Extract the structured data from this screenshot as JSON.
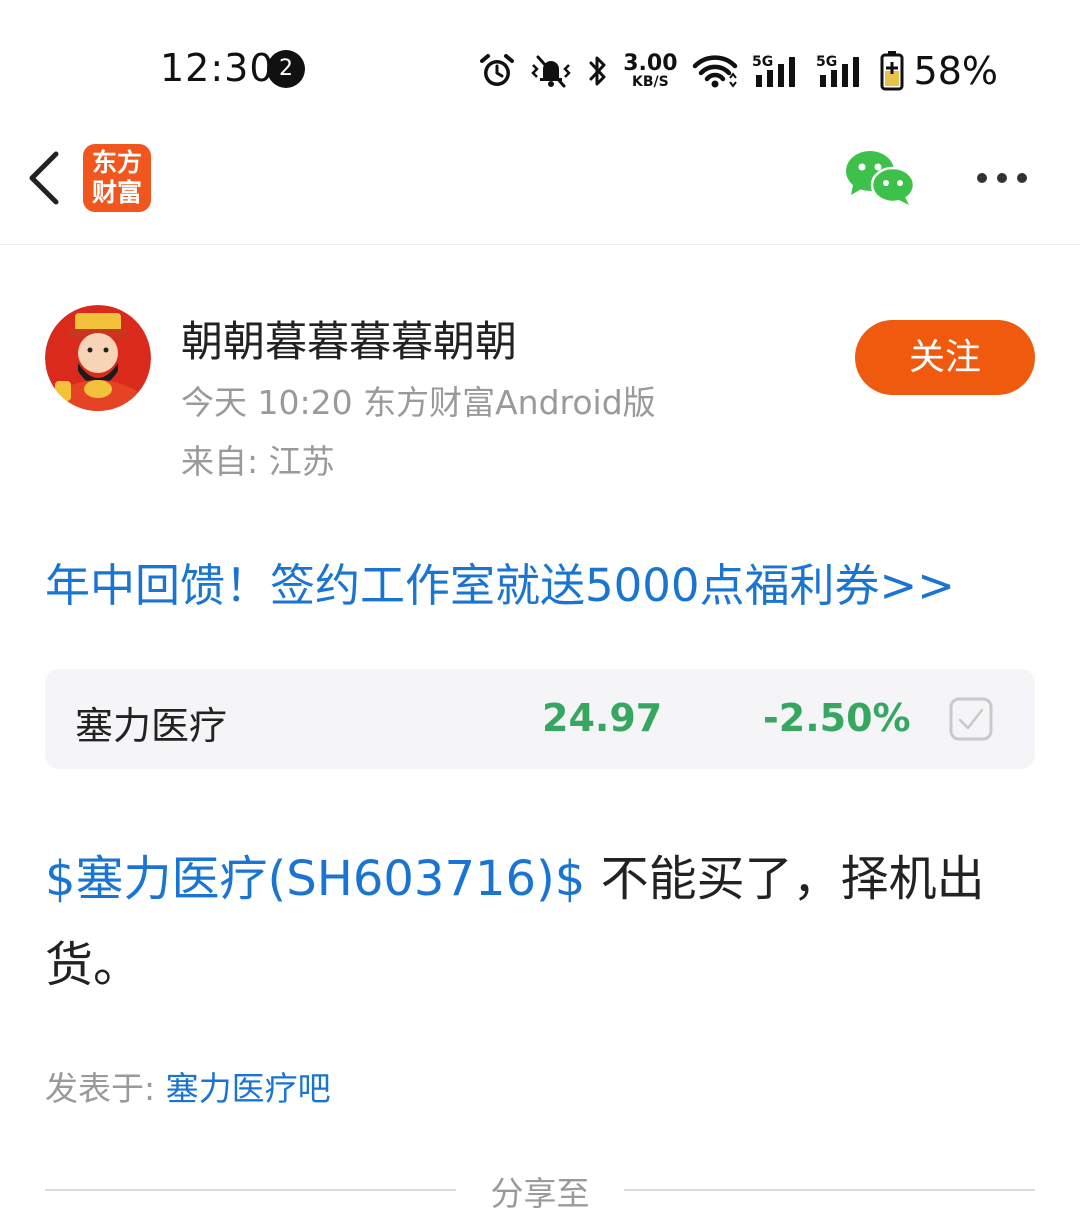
{
  "status_bar": {
    "time": "12:30",
    "notification_count": "2",
    "net_speed_value": "3.00",
    "net_speed_unit": "KB/S",
    "signal_1_label": "5G",
    "signal_2_label": "5G",
    "battery_percent": "58%",
    "icons": [
      "alarm-icon",
      "silent-vibrate-icon",
      "bluetooth-icon",
      "wifi-icon",
      "signal-5g-icon",
      "signal-5g-icon",
      "battery-charging-icon"
    ]
  },
  "nav": {
    "logo_line1": "东方",
    "logo_line2": "财富",
    "icons": [
      "back-icon",
      "wechat-icon",
      "more-icon"
    ]
  },
  "author": {
    "name": "朝朝暮暮暮暮朝朝",
    "meta": "今天 10:20 东方财富Android版",
    "location": "来自: 江苏",
    "follow_label": "关注"
  },
  "promo": {
    "text": "年中回馈！签约工作室就送5000点福利券>>"
  },
  "stock": {
    "name": "塞力医疗",
    "price": "24.97",
    "change": "-2.50%",
    "color": "#37a660"
  },
  "post": {
    "stock_tag": "$塞力医疗(SH603716)$",
    "text": " 不能买了，择机出货。"
  },
  "footer": {
    "posted_in_label": "发表于: ",
    "forum_name": "塞力医疗吧",
    "share_label": "分享至"
  },
  "colors": {
    "accent_blue": "#1a75d2",
    "follow_orange": "#ef5a0f",
    "logo_orange": "#f0561e",
    "wechat_green": "#3ec14b",
    "stock_down_green": "#37a660"
  }
}
